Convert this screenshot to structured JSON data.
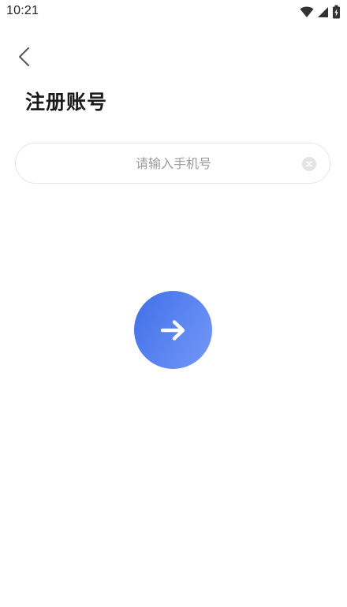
{
  "status_bar": {
    "time": "10:21",
    "icons": [
      "wifi-icon",
      "cellular-signal-icon",
      "battery-charging-icon"
    ]
  },
  "header": {
    "back_icon": "chevron-left-icon",
    "title": "注册账号"
  },
  "phone_field": {
    "value": "",
    "placeholder": "请输入手机号",
    "clear_icon": "clear-circle-icon"
  },
  "next_button": {
    "icon": "arrow-right-icon",
    "gradient_start": "#3f6fe6",
    "gradient_end": "#7598f6"
  },
  "colors": {
    "accent": "#4a78ec",
    "background": "#ffffff",
    "placeholder": "#9a9a9a",
    "border": "#e6e6e6"
  }
}
